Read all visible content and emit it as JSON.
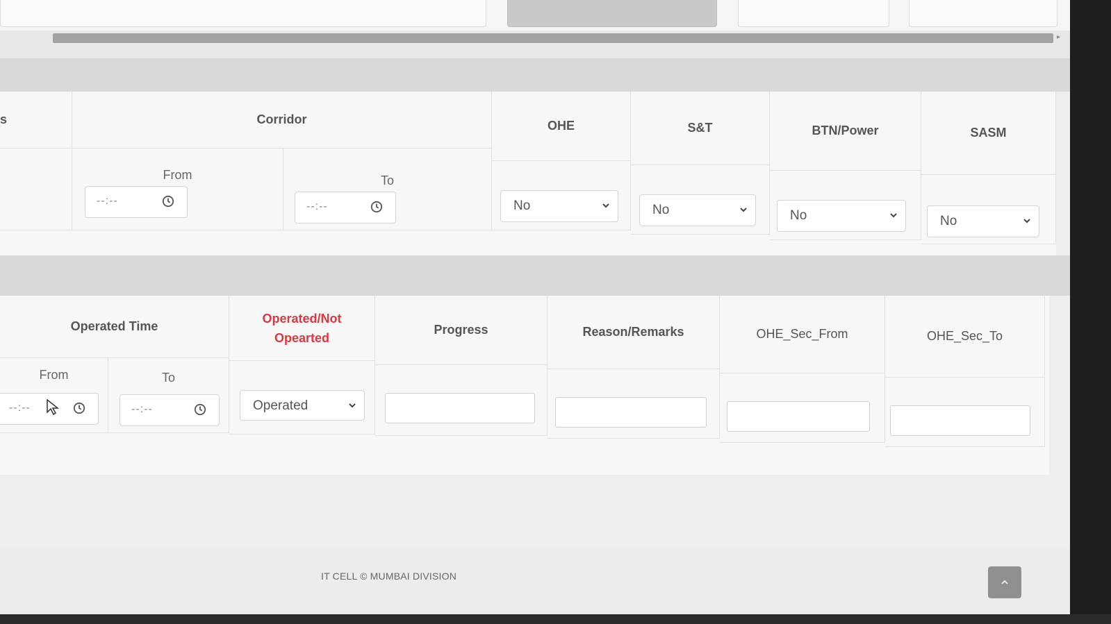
{
  "section1": {
    "truncated_label": "s",
    "corridor": {
      "header": "Corridor",
      "from_label": "From",
      "to_label": "To",
      "from_placeholder": "--:--",
      "to_placeholder": "--:--"
    },
    "columns": [
      {
        "key": "ohe",
        "header": "OHE",
        "value": "No"
      },
      {
        "key": "snt",
        "header": "S&T",
        "value": "No"
      },
      {
        "key": "btn_power",
        "header": "BTN/Power",
        "value": "No"
      },
      {
        "key": "sasm",
        "header": "SASM",
        "value": "No"
      }
    ]
  },
  "section2": {
    "operated_time": {
      "header": "Operated Time",
      "from_label": "From",
      "to_label": "To",
      "from_placeholder": "--:--",
      "to_placeholder": "--:--"
    },
    "operated_status": {
      "header": "Operated/Not Opearted",
      "value": "Operated"
    },
    "progress_header": "Progress",
    "remarks_header": "Reason/Remarks",
    "ohe_sec_from_header": "OHE_Sec_From",
    "ohe_sec_to_header": "OHE_Sec_To"
  },
  "footer": {
    "text": "IT CELL © MUMBAI DIVISION"
  },
  "colors": {
    "accent_red": "#d83a43",
    "panel_bg": "#f7f7f7",
    "page_bg": "#eeeeee"
  }
}
